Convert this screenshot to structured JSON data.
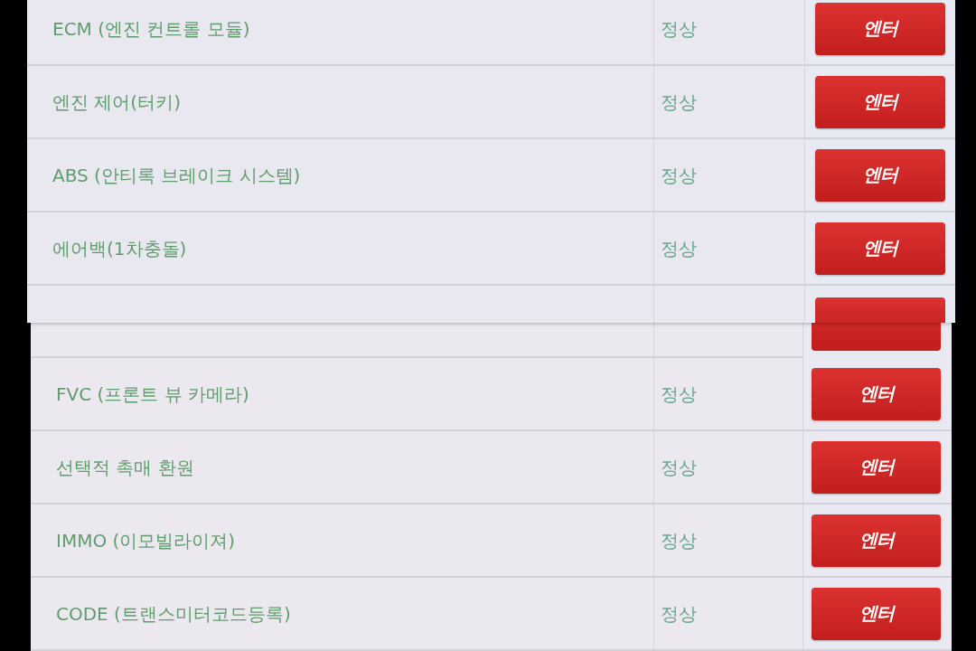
{
  "screens": [
    {
      "rows": [
        {
          "kind": "full",
          "label": "ECM (엔진 컨트롤 모듈)",
          "status": "정상",
          "button": "엔터"
        },
        {
          "kind": "full",
          "label": "엔진 제어(터키)",
          "status": "정상",
          "button": "엔터"
        },
        {
          "kind": "full",
          "label": "ABS (안티록 브레이크 시스템)",
          "status": "정상",
          "button": "엔터"
        },
        {
          "kind": "full",
          "label": "에어백(1차충돌)",
          "status": "정상",
          "button": "엔터"
        },
        {
          "kind": "clipped_bottom"
        }
      ]
    },
    {
      "rows": [
        {
          "kind": "clipped_top"
        },
        {
          "kind": "full",
          "label": "FVC (프론트 뷰 카메라)",
          "status": "정상",
          "button": "엔터"
        },
        {
          "kind": "full",
          "label": "선택적 촉매 환원",
          "status": "정상",
          "button": "엔터"
        },
        {
          "kind": "full",
          "label": "IMMO (이모빌라이져)",
          "status": "정상",
          "button": "엔터"
        },
        {
          "kind": "full",
          "label": "CODE (트랜스미터코드등록)",
          "status": "정상",
          "button": "엔터"
        }
      ]
    }
  ]
}
